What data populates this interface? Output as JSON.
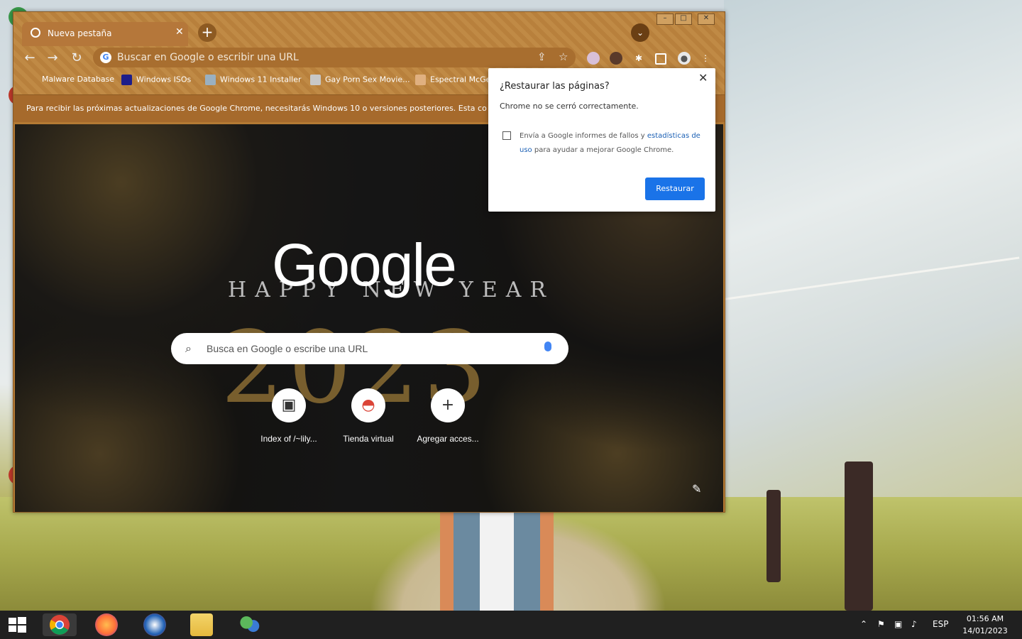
{
  "window": {
    "tab_title": "Nueva pestaña",
    "omnibox_placeholder": "Buscar en Google o escribir una URL",
    "bookmarks": [
      "Malware Database",
      "Windows ISOs",
      "Windows 11 Installer",
      "Gay Porn Sex Movie...",
      "Espectral McGe..."
    ],
    "notice": "Para recibir las próximas actualizaciones de Google Chrome, necesitarás Windows 10 o versiones posteriores. Esta co"
  },
  "ntp": {
    "logo": "Google",
    "happy": "HAPPY NEW YEAR",
    "year": "2023",
    "search_placeholder": "Busca en Google o escribe una URL",
    "shortcuts": [
      "Index of /~lily...",
      "Tienda virtual",
      "Agregar acces..."
    ]
  },
  "dialog": {
    "title": "¿Restaurar las páginas?",
    "subtitle": "Chrome no se cerró correctamente.",
    "checkbox_pre": "Envía a Google informes de fallos y ",
    "checkbox_link": "estadísticas de uso",
    "checkbox_post": " para ayudar a mejorar Google Chrome.",
    "button": "Restaurar"
  },
  "taskbar": {
    "lang": "ESP",
    "time": "01:56 AM",
    "date": "14/01/2023"
  },
  "colors": {
    "accent": "#1a73e8",
    "theme": "#b47a34"
  }
}
